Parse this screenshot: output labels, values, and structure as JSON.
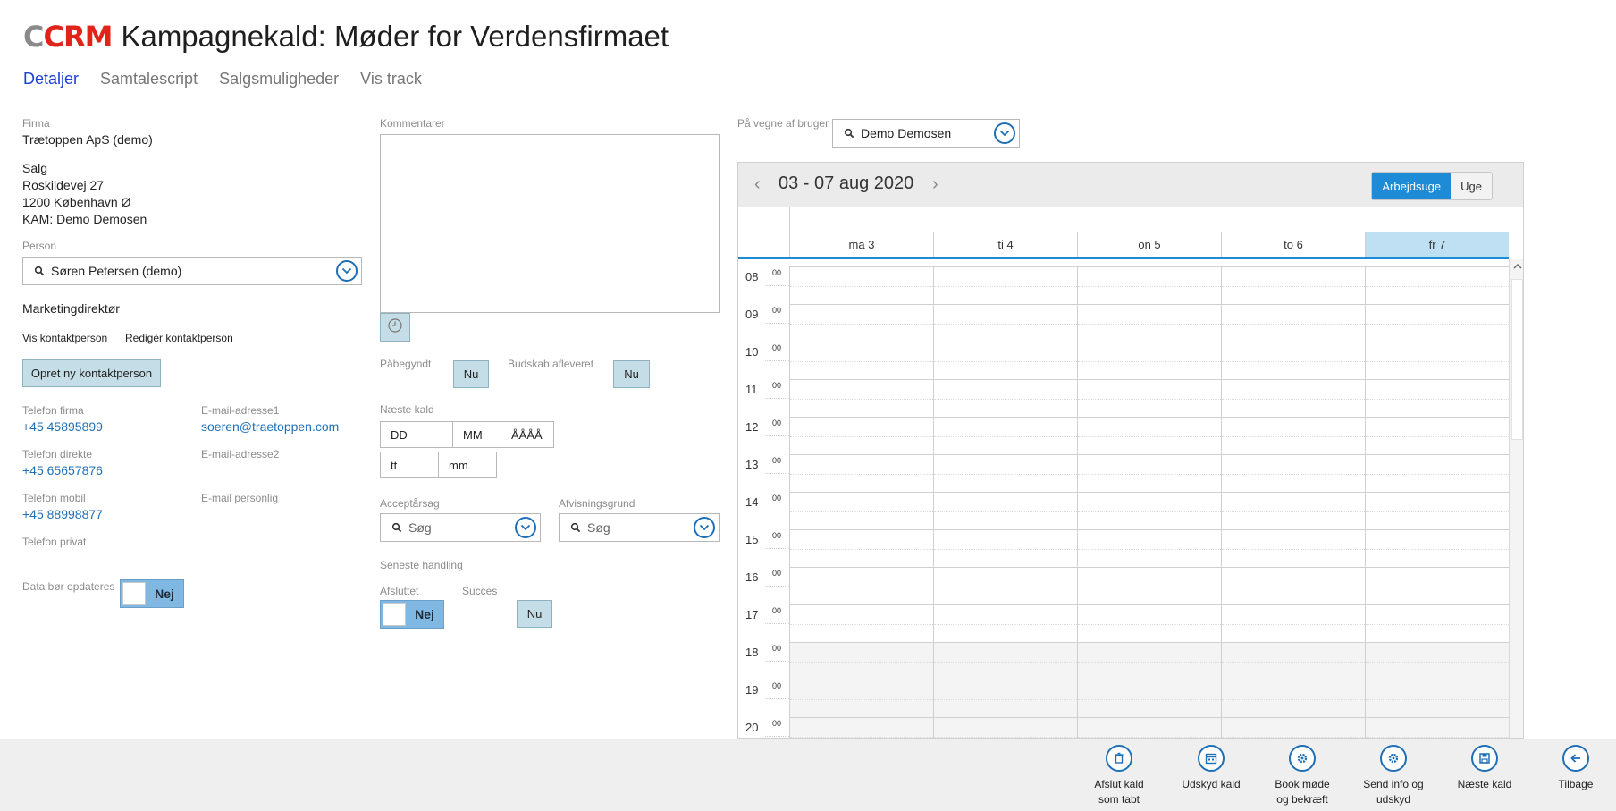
{
  "header": {
    "logo_c": "C",
    "logo_crm": "CRM",
    "title": "Kampagnekald: Møder for Verdensfirmaet"
  },
  "tabs": [
    {
      "label": "Detaljer",
      "active": true
    },
    {
      "label": "Samtalescript",
      "active": false
    },
    {
      "label": "Salgsmuligheder",
      "active": false
    },
    {
      "label": "Vis track",
      "active": false
    }
  ],
  "company": {
    "label": "Firma",
    "name": "Trætoppen ApS (demo)",
    "dept": "Salg",
    "street": "Roskildevej 27",
    "city": "1200 København Ø",
    "kam": "KAM: Demo Demosen"
  },
  "person": {
    "label": "Person",
    "value": "Søren Petersen (demo)",
    "role": "Marketingdirektør",
    "view_link": "Vis kontaktperson",
    "edit_link": "Redigér kontaktperson",
    "new_button": "Opret ny kontaktperson"
  },
  "contact": {
    "phone_company_label": "Telefon firma",
    "phone_company": "+45 45895899",
    "phone_direct_label": "Telefon direkte",
    "phone_direct": "+45 65657876",
    "phone_mobile_label": "Telefon mobil",
    "phone_mobile": "+45 88998877",
    "phone_private_label": "Telefon privat",
    "email1_label": "E-mail-adresse1",
    "email1": "soeren@traetoppen.com",
    "email2_label": "E-mail-adresse2",
    "email_personal_label": "E-mail personlig"
  },
  "data_update": {
    "label": "Data bør opdateres",
    "toggle": "Nej"
  },
  "comments": {
    "label": "Kommentarer"
  },
  "started": {
    "label": "Påbegyndt",
    "button": "Nu"
  },
  "message_delivered": {
    "label": "Budskab afleveret",
    "button": "Nu"
  },
  "next_call": {
    "label": "Næste kald",
    "day_ph": "DD",
    "month_ph": "MM",
    "year_ph": "ÅÅÅÅ",
    "hour_ph": "tt",
    "minute_ph": "mm"
  },
  "accept_reason": {
    "label": "Acceptårsag",
    "placeholder": "Søg"
  },
  "reject_reason": {
    "label": "Afvisningsgrund",
    "placeholder": "Søg"
  },
  "last_action": {
    "label": "Seneste handling",
    "finished_label": "Afsluttet",
    "finished_toggle": "Nej",
    "success_label": "Succes",
    "success_button": "Nu"
  },
  "on_behalf": {
    "label": "På vegne af bruger",
    "value": "Demo Demosen"
  },
  "calendar": {
    "range": "03 - 07 aug 2020",
    "prev": "‹",
    "next": "›",
    "view_workweek": "Arbejdsuge",
    "view_week": "Uge",
    "days": [
      {
        "label": "ma 3",
        "today": false
      },
      {
        "label": "ti 4",
        "today": false
      },
      {
        "label": "on 5",
        "today": false
      },
      {
        "label": "to 6",
        "today": false
      },
      {
        "label": "fr 7",
        "today": true
      }
    ],
    "hours": [
      {
        "h": "08",
        "m": "00"
      },
      {
        "h": "09",
        "m": "00"
      },
      {
        "h": "10",
        "m": "00"
      },
      {
        "h": "11",
        "m": "00"
      },
      {
        "h": "12",
        "m": "00"
      },
      {
        "h": "13",
        "m": "00"
      },
      {
        "h": "14",
        "m": "00"
      },
      {
        "h": "15",
        "m": "00"
      },
      {
        "h": "16",
        "m": "00"
      },
      {
        "h": "17",
        "m": "00"
      },
      {
        "h": "18",
        "m": "00"
      },
      {
        "h": "19",
        "m": "00"
      },
      {
        "h": "20",
        "m": "00"
      }
    ]
  },
  "footer": [
    {
      "label": "Afslut kald\nsom tabt",
      "icon": "trash-icon"
    },
    {
      "label": "Udskyd kald",
      "icon": "calendar-icon"
    },
    {
      "label": "Book møde\nog bekræft",
      "icon": "gear-icon"
    },
    {
      "label": "Send info og\nudskyd",
      "icon": "gear-icon"
    },
    {
      "label": "Næste kald",
      "icon": "save-icon"
    },
    {
      "label": "Tilbage",
      "icon": "arrow-left-icon"
    }
  ],
  "colors": {
    "accent": "#1e8bd6",
    "link": "#1f6fb7",
    "brand_red": "#e2231a",
    "today_bg": "#bfe0f3"
  }
}
